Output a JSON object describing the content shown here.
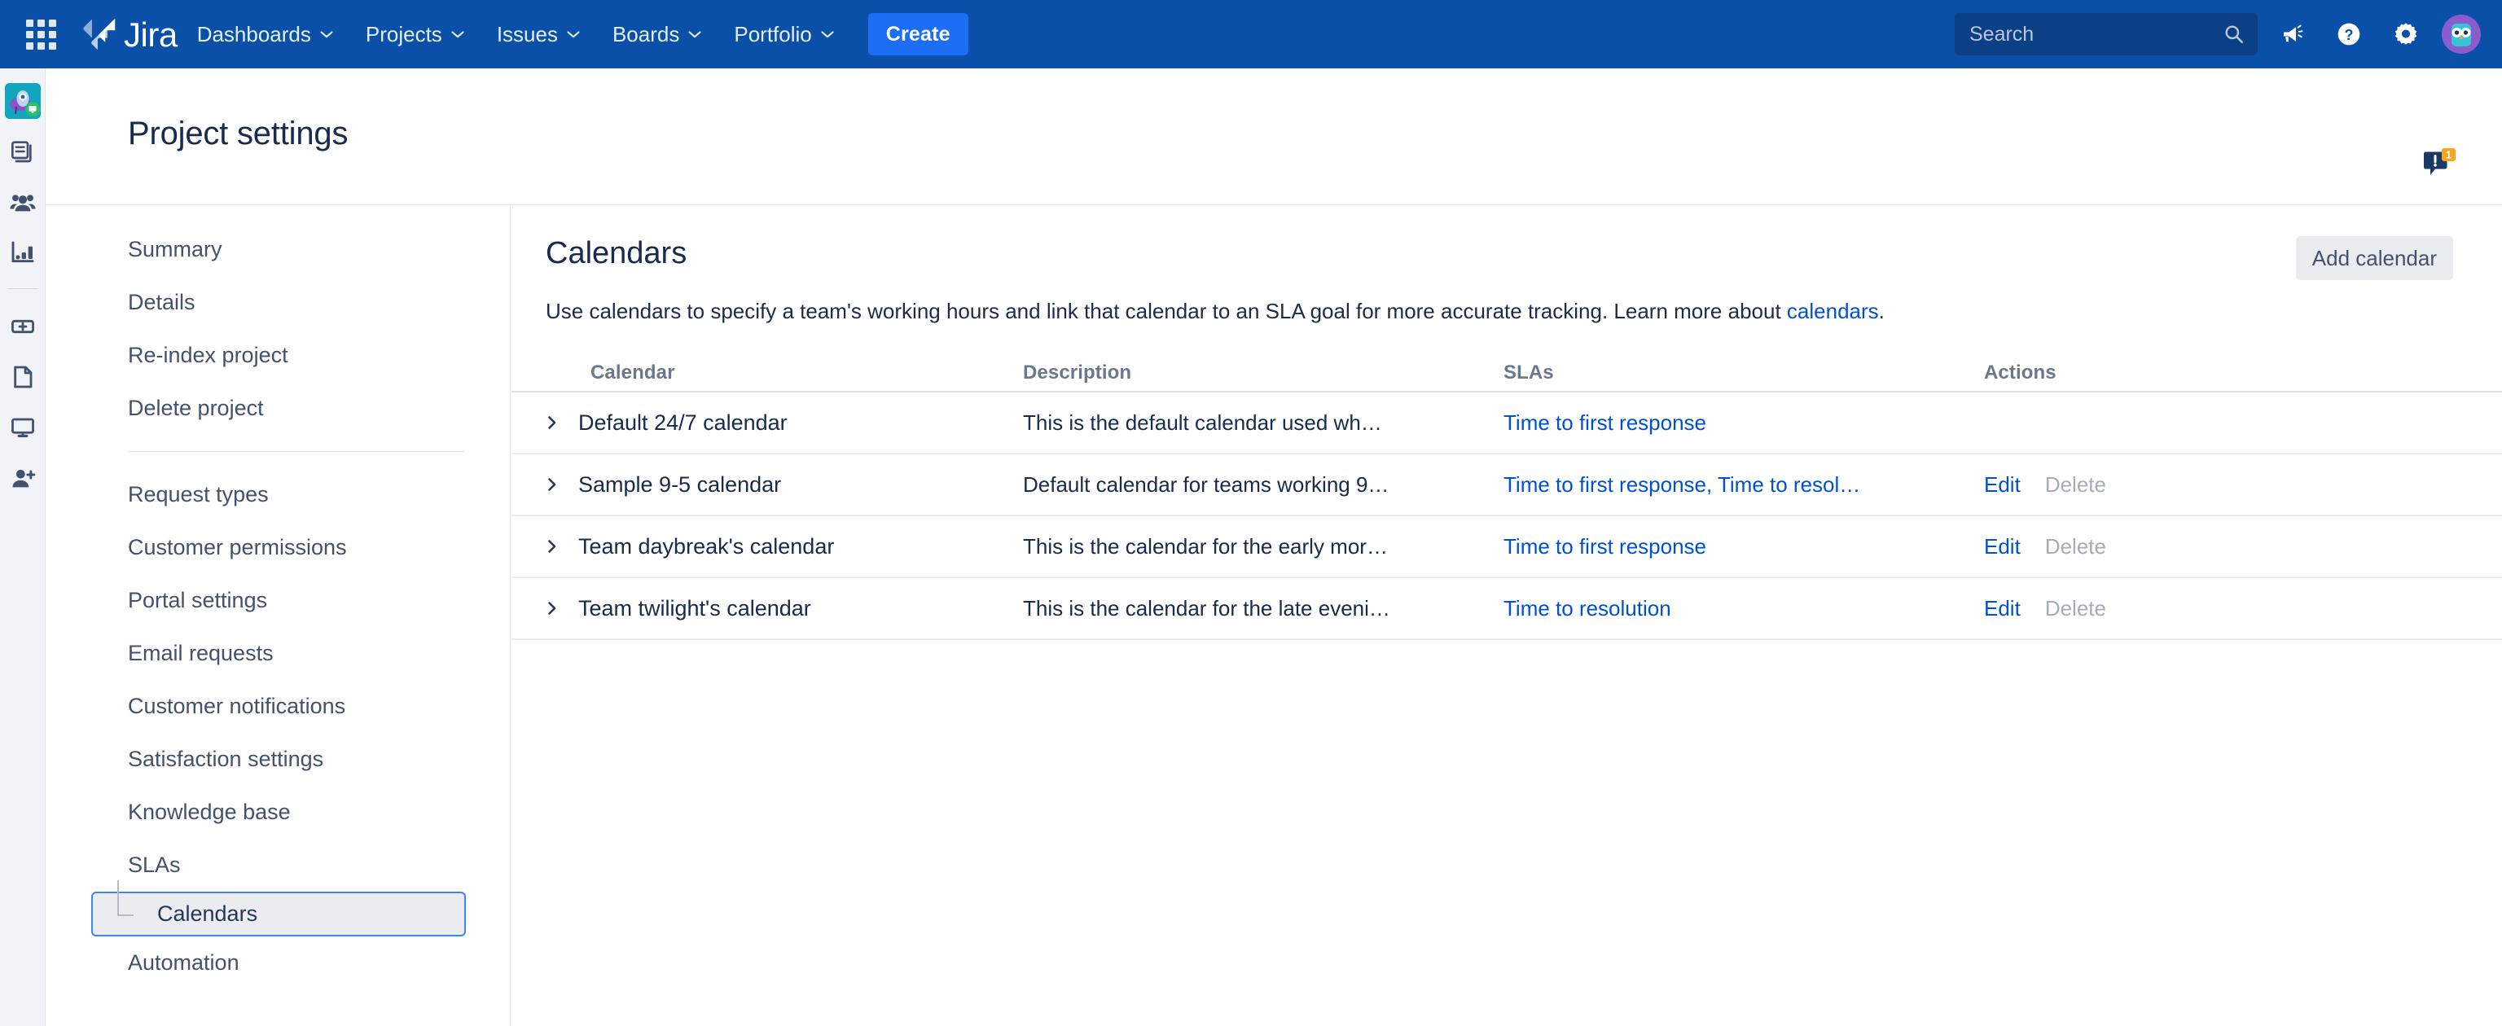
{
  "topnav": {
    "app_switcher_label": "app-switcher",
    "logo_text": "Jira",
    "menu": [
      {
        "label": "Dashboards",
        "has_caret": true
      },
      {
        "label": "Projects",
        "has_caret": true
      },
      {
        "label": "Issues",
        "has_caret": true
      },
      {
        "label": "Boards",
        "has_caret": true
      },
      {
        "label": "Portfolio",
        "has_caret": true
      }
    ],
    "create_label": "Create",
    "search_placeholder": "Search",
    "search_value": "",
    "icons": [
      "announcement-icon",
      "help-icon",
      "settings-gear-icon",
      "user-avatar"
    ]
  },
  "rail": {
    "items": [
      "project-avatar",
      "queues-icon",
      "customers-icon",
      "reports-icon",
      "add-item-icon",
      "knowledge-base-icon",
      "portal-icon",
      "invite-team-icon"
    ]
  },
  "page": {
    "title": "Project settings",
    "feedback_badge": "1"
  },
  "settings_nav": {
    "group1": [
      {
        "label": "Summary"
      },
      {
        "label": "Details"
      },
      {
        "label": "Re-index project"
      },
      {
        "label": "Delete project"
      }
    ],
    "group2": [
      {
        "label": "Request types"
      },
      {
        "label": "Customer permissions"
      },
      {
        "label": "Portal settings"
      },
      {
        "label": "Email requests"
      },
      {
        "label": "Customer notifications"
      },
      {
        "label": "Satisfaction settings"
      },
      {
        "label": "Knowledge base"
      },
      {
        "label": "SLAs"
      }
    ],
    "selected_sub": {
      "label": "Calendars"
    },
    "after_selected": [
      {
        "label": "Automation"
      }
    ]
  },
  "main": {
    "heading": "Calendars",
    "add_button": "Add calendar",
    "description_prefix": "Use calendars to specify a team's working hours and link that calendar to an SLA goal for more accurate tracking. Learn more about ",
    "description_link": "calendars",
    "description_suffix": ".",
    "table": {
      "columns": [
        "Calendar",
        "Description",
        "SLAs",
        "Actions"
      ],
      "rows": [
        {
          "name": "Default 24/7 calendar",
          "description": "This is the default calendar used wh…",
          "slas": "Time to first response",
          "edit": "",
          "delete": "",
          "has_actions": false
        },
        {
          "name": "Sample 9-5 calendar",
          "description": "Default calendar for teams working 9…",
          "slas": "Time to first response, Time to resol…",
          "edit": "Edit",
          "delete": "Delete",
          "has_actions": true
        },
        {
          "name": "Team daybreak's calendar",
          "description": "This is the calendar for the early mor…",
          "slas": "Time to first response",
          "edit": "Edit",
          "delete": "Delete",
          "has_actions": true
        },
        {
          "name": "Team twilight's calendar",
          "description": "This is the calendar for the late eveni…",
          "slas": "Time to resolution",
          "edit": "Edit",
          "delete": "Delete",
          "has_actions": true
        }
      ]
    }
  },
  "colors": {
    "nav_bg": "#0a4fa8",
    "create_btn": "#1d6df5",
    "link": "#0052cc",
    "text_primary": "#172b4d",
    "text_muted": "#6b778c",
    "selected_border": "#3d84f6"
  }
}
